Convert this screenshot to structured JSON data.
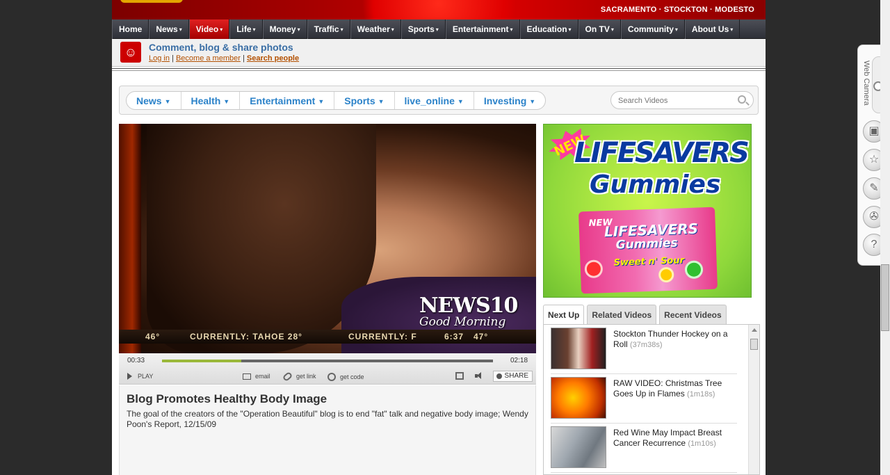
{
  "header": {
    "cities": "SACRAMENTO · STOCKTON · MODESTO"
  },
  "main_nav": {
    "items": [
      {
        "label": "Home",
        "caret": ""
      },
      {
        "label": "News",
        "caret": "▾"
      },
      {
        "label": "Video",
        "caret": "▾"
      },
      {
        "label": "Life",
        "caret": "▾"
      },
      {
        "label": "Money",
        "caret": "▾"
      },
      {
        "label": "Traffic",
        "caret": "▾"
      },
      {
        "label": "Weather",
        "caret": "▾"
      },
      {
        "label": "Sports",
        "caret": "▾"
      },
      {
        "label": "Entertainment",
        "caret": "▾"
      },
      {
        "label": "Education",
        "caret": "▾"
      },
      {
        "label": "On TV",
        "caret": "▾"
      },
      {
        "label": "Community",
        "caret": "▾"
      },
      {
        "label": "About Us",
        "caret": "▾"
      }
    ],
    "active": "Video"
  },
  "community": {
    "title": "Comment, blog & share photos",
    "login": "Log in",
    "sep1": "|",
    "member": "Become a member",
    "sep2": "|",
    "search_people": "Search people"
  },
  "video_nav": {
    "items": [
      {
        "label": "News",
        "tri": "▼"
      },
      {
        "label": "Health",
        "tri": "▼"
      },
      {
        "label": "Entertainment",
        "tri": "▼"
      },
      {
        "label": "Sports",
        "tri": "▼"
      },
      {
        "label": "live_online",
        "tri": "▼"
      },
      {
        "label": "Investing",
        "tri": "▼"
      }
    ],
    "search_placeholder": "Search Videos"
  },
  "player": {
    "overlay_logo": "NEWS10",
    "overlay_sub": "Good Morning",
    "ticker": [
      "46°",
      "CURRENTLY: TAHOE 28°",
      "CURRENTLY: F",
      "6:37",
      "47°"
    ],
    "elapsed": "00:33",
    "duration": "02:18",
    "progress": 0.24,
    "play_label": "PLAY",
    "email_label": "email",
    "link_label": "get link",
    "code_label": "get code",
    "share_label": "SHARE"
  },
  "video": {
    "title": "Blog Promotes Healthy Body Image",
    "description": "The goal of the creators of the \"Operation Beautiful\" blog is to end \"fat\" talk and negative body image; Wendy Poon's Report, 12/15/09"
  },
  "ad": {
    "new_badge": "NEW",
    "brand_line1": "LIFESAVERS",
    "brand_line2": "Gummies",
    "pack_new": "NEW",
    "pack_brand": "LIFESAVERS",
    "pack_gummies": "Gummies",
    "pack_flavor": "Sweet n' Sour"
  },
  "playlist": {
    "tabs": [
      "Next Up",
      "Related Videos",
      "Recent Videos"
    ],
    "active_tab": "Next Up",
    "items": [
      {
        "title": "Stockton Thunder Hockey on a Roll",
        "duration": "(37m38s)"
      },
      {
        "title": "RAW VIDEO: Christmas Tree Goes Up in Flames",
        "duration": "(1m18s)"
      },
      {
        "title": "Red Wine May Impact Breast Cancer Recurrence",
        "duration": "(1m10s)"
      }
    ]
  },
  "browser_toolbar": {
    "webcam_label": "Web Camera",
    "help_glyph": "?"
  }
}
